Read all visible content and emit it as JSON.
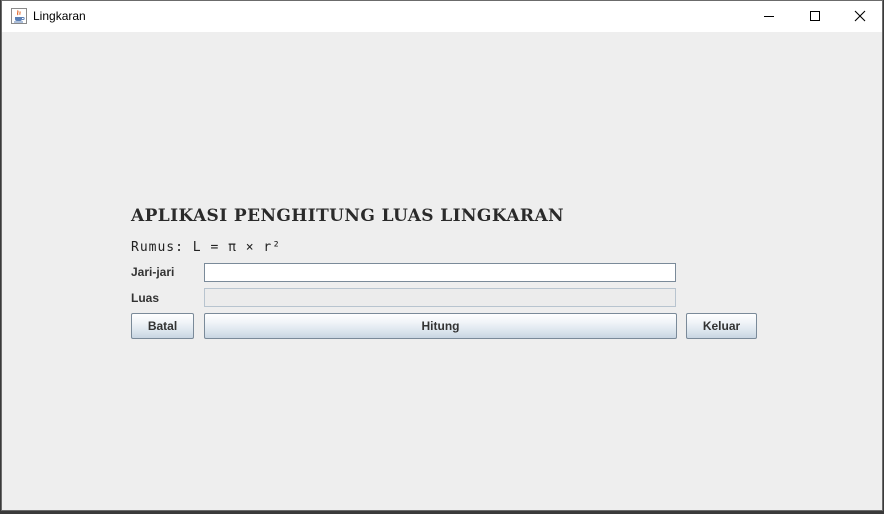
{
  "window": {
    "title": "Lingkaran",
    "icon": "java-cup-icon",
    "controls": [
      "minimize-icon",
      "maximize-icon",
      "close-icon"
    ]
  },
  "content": {
    "heading": "APLIKASI PENGHITUNG LUAS LINGKARAN",
    "formula": "Rumus: L = π × r²",
    "jari_label": "Jari-jari",
    "jari_value": "",
    "luas_label": "Luas",
    "luas_value": ""
  },
  "buttons": {
    "batal": "Batal",
    "hitung": "Hitung",
    "keluar": "Keluar"
  },
  "colors": {
    "background": "#eeeeee",
    "titlebar": "#ffffff",
    "button_border": "#7a8a99"
  }
}
